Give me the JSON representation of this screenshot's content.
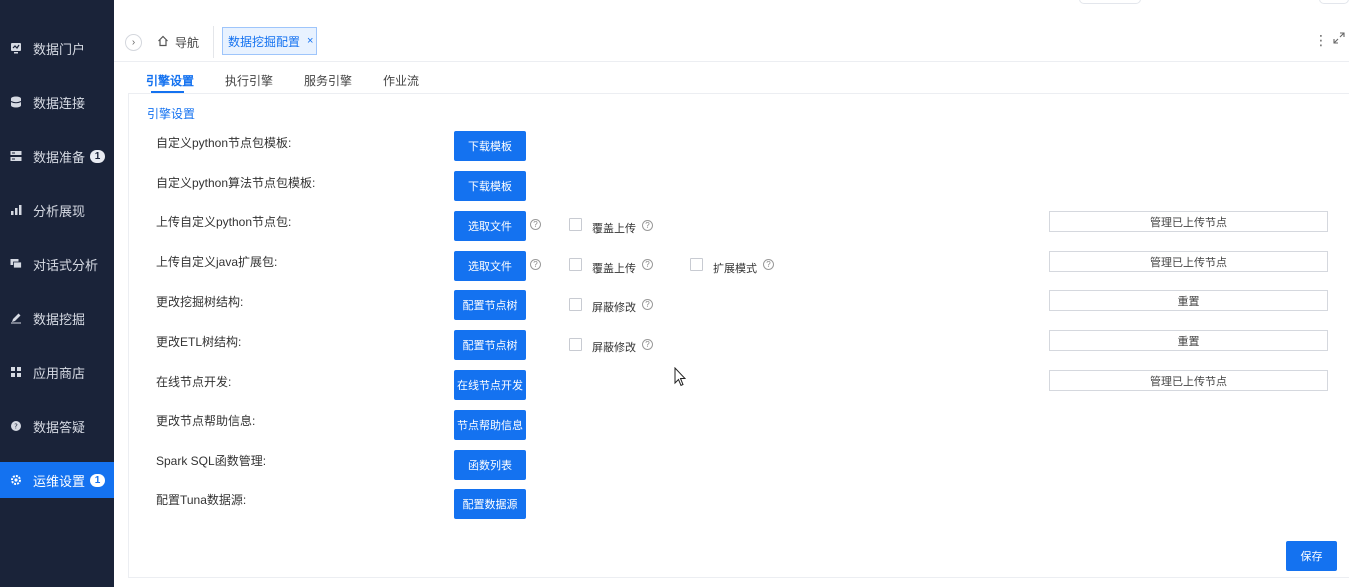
{
  "sidebar": {
    "items": [
      {
        "label": "数据门户",
        "icon": "monitor-icon",
        "badge": ""
      },
      {
        "label": "数据连接",
        "icon": "database-icon",
        "badge": ""
      },
      {
        "label": "数据准备",
        "icon": "server-icon",
        "badge": "1"
      },
      {
        "label": "分析展现",
        "icon": "bar-chart-icon",
        "badge": ""
      },
      {
        "label": "对话式分析",
        "icon": "chat-icon",
        "badge": ""
      },
      {
        "label": "数据挖掘",
        "icon": "pen-icon",
        "badge": ""
      },
      {
        "label": "应用商店",
        "icon": "apps-grid-icon",
        "badge": ""
      },
      {
        "label": "数据答疑",
        "icon": "question-bubble-icon",
        "badge": ""
      },
      {
        "label": "运维设置",
        "icon": "gear-icon",
        "badge": "1",
        "active": true
      }
    ]
  },
  "tabbar": {
    "nav_label": "导航",
    "active_tab": "数据挖掘配置",
    "close": "×"
  },
  "subtabs": [
    "引擎设置",
    "执行引擎",
    "服务引擎",
    "作业流"
  ],
  "panel": {
    "section_title": "引擎设置",
    "rows": [
      {
        "label": "自定义python节点包模板:",
        "button": "下载模板"
      },
      {
        "label": "自定义python算法节点包模板:",
        "button": "下载模板"
      },
      {
        "label": "上传自定义python节点包:",
        "button": "选取文件",
        "check1": "覆盖上传",
        "right_button": "管理已上传节点"
      },
      {
        "label": "上传自定义java扩展包:",
        "button": "选取文件",
        "check1": "覆盖上传",
        "check2": "扩展模式",
        "right_button": "管理已上传节点"
      },
      {
        "label": "更改挖掘树结构:",
        "button": "配置节点树",
        "check1": "屏蔽修改",
        "right_button": "重置"
      },
      {
        "label": "更改ETL树结构:",
        "button": "配置节点树",
        "check1": "屏蔽修改",
        "right_button": "重置"
      },
      {
        "label": "在线节点开发:",
        "button": "在线节点开发",
        "right_button": "管理已上传节点"
      },
      {
        "label": "更改节点帮助信息:",
        "button": "节点帮助信息"
      },
      {
        "label": "Spark SQL函数管理:",
        "button": "函数列表"
      },
      {
        "label": "配置Tuna数据源:",
        "button": "配置数据源"
      }
    ],
    "save": "保存"
  },
  "colors": {
    "sidebar_bg": "#1a2339",
    "primary": "#1472f0"
  }
}
